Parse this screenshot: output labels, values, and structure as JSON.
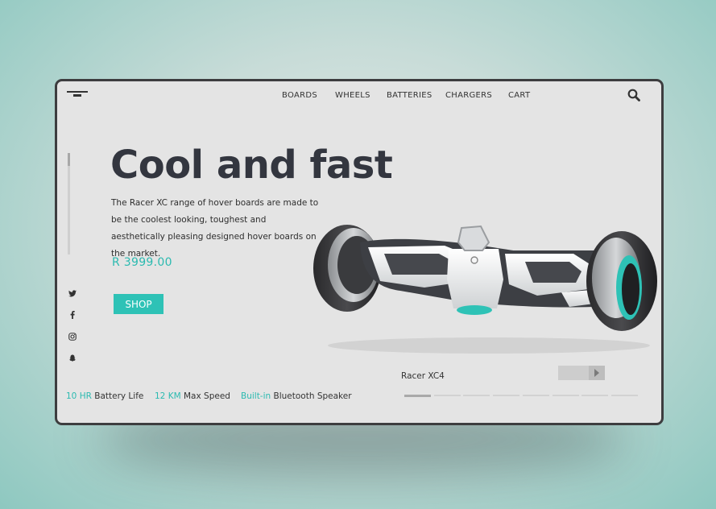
{
  "nav": {
    "items": [
      "BOARDS",
      "WHEELS",
      "BATTERIES",
      "CHARGERS",
      "CART"
    ]
  },
  "icons": {
    "menu": "menu-icon",
    "search": "search-icon",
    "social": [
      "twitter-icon",
      "facebook-icon",
      "instagram-icon",
      "snapchat-icon"
    ]
  },
  "hero": {
    "headline": "Cool and fast",
    "description": "The Racer XC range of hover boards are made to be the coolest looking, toughest and aesthetically pleasing designed hover boards on the  market.",
    "price": "R 3999.00",
    "shop_label": "SHOP"
  },
  "features": [
    {
      "highlight": "10 HR",
      "text": "Battery Life"
    },
    {
      "highlight": "12 KM",
      "text": "Max Speed"
    },
    {
      "highlight": "Built-in",
      "text": "Bluetooth Speaker"
    }
  ],
  "carousel": {
    "label": "Racer XC4",
    "total_slides": 8,
    "active_index": 0
  },
  "colors": {
    "accent": "#2ec2b6",
    "accent_text": "#2bbab0",
    "frame": "#3d3d3f",
    "panel": "#e4e4e4",
    "headline": "#33363f"
  }
}
